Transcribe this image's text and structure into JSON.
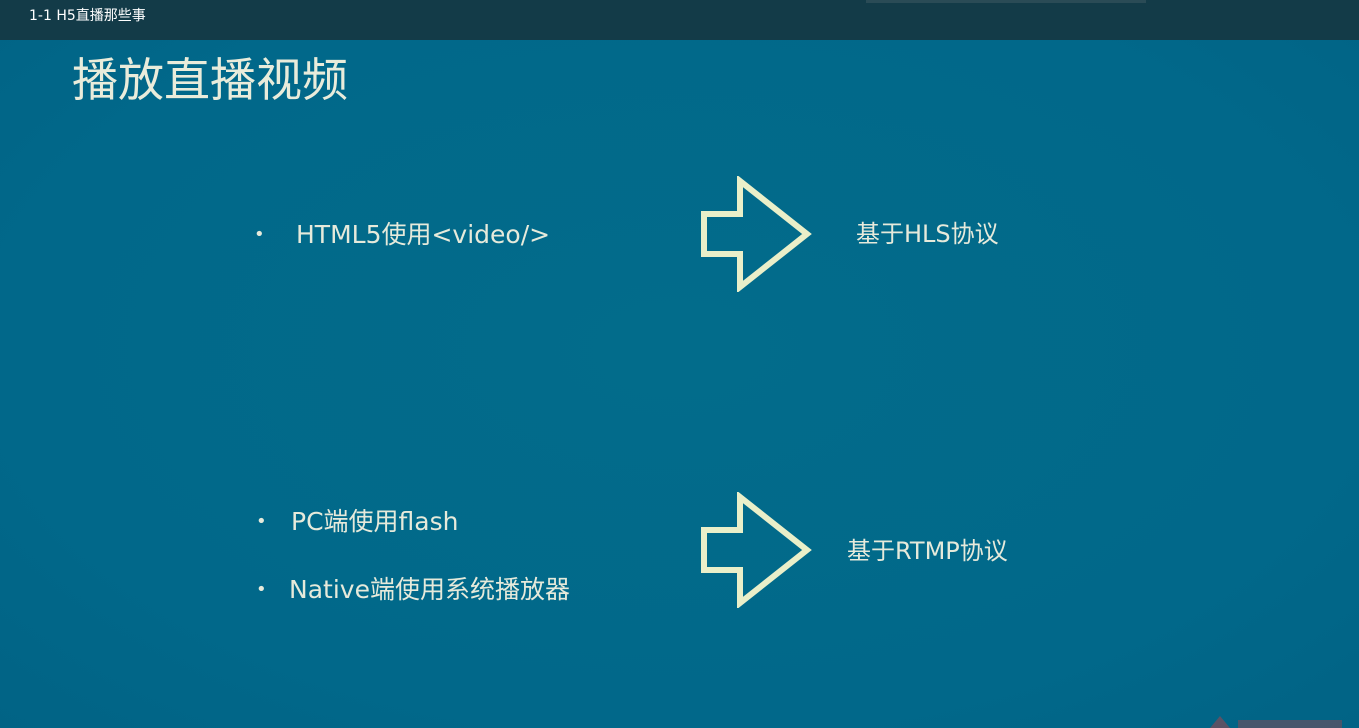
{
  "window": {
    "title": "1-1 H5直播那些事"
  },
  "slide": {
    "title": "播放直播视频",
    "row1": {
      "bullets": [
        "HTML5使用<video/>"
      ],
      "result": "基于HLS协议"
    },
    "row2": {
      "bullets": [
        "PC端使用flash",
        "Native端使用系统播放器"
      ],
      "result": "基于RTMP协议"
    }
  },
  "colors": {
    "slide_background": "#016a89",
    "top_bar": "#133b48",
    "text": "#e6eadb"
  },
  "icons": {
    "arrow": "right-arrow-outline-icon",
    "bullet": "bullet-dot-icon"
  }
}
